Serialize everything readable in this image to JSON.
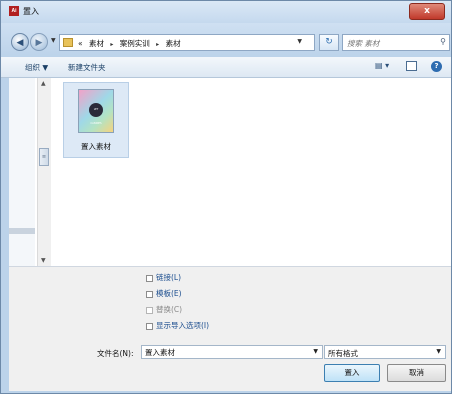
{
  "window": {
    "title": "置入",
    "app_icon": "Ai",
    "close_glyph": "x"
  },
  "address": {
    "back_glyph": "◀",
    "forward_glyph": "▶",
    "crumbs": [
      "«",
      "素材",
      "▸",
      "案例实训",
      "▸",
      "素材"
    ],
    "refresh_glyph": "↻",
    "search_placeholder": "搜索 素材"
  },
  "toolbar": {
    "organize_label": "组织 ▼",
    "new_folder_label": "新建文件夹"
  },
  "files": [
    {
      "name": "置入素材",
      "thumb_text": "LET CANDIES"
    }
  ],
  "options": [
    {
      "label": "链接(L)",
      "enabled": true
    },
    {
      "label": "模板(E)",
      "enabled": true
    },
    {
      "label": "替换(C)",
      "enabled": false
    },
    {
      "label": "显示导入选项(I)",
      "enabled": true
    }
  ],
  "footer": {
    "filename_label": "文件名(N):",
    "filename_value": "置入素材",
    "filter_value": "所有格式",
    "place_button": "置入",
    "cancel_button": "取消"
  },
  "colors": {
    "accent": "#2e6cb0",
    "close_button": "#c0392b",
    "option_link": "#1c4e8f"
  }
}
